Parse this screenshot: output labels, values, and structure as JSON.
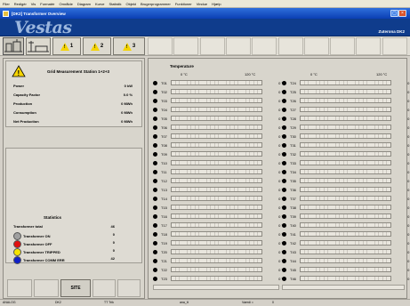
{
  "menu": [
    "Filer",
    "Redigér",
    "Vis",
    "Formatér",
    "Områlde",
    "Diagram",
    "Kurve",
    "Statistik",
    "Objekt",
    "Brugerprogrammer",
    "Funktioner",
    "Vindue",
    "Hjælp"
  ],
  "window_title": "[DK2] Transformer Overview",
  "banner": {
    "logo": "Vestas",
    "zone": "Zuterona DK2"
  },
  "toolbar": {
    "btn3": "1",
    "btn4": "2",
    "btn5": "3"
  },
  "station": {
    "title": "Grid Measurement Station 1+2+3",
    "rows": [
      {
        "label": "Power",
        "value": "0 kW"
      },
      {
        "label": "Capacity Factor",
        "value": "0.0 %"
      },
      {
        "label": "Production",
        "value": "0 MWh"
      },
      {
        "label": "Consumption",
        "value": "0 MWh"
      },
      {
        "label": "Net Production",
        "value": "0 MWh"
      }
    ]
  },
  "statistics": {
    "title": "Statistics",
    "total_label": "Transformer total",
    "total_value": "46",
    "rows": [
      {
        "label": "Transformer ON",
        "value": "0",
        "color": "#a0a0a0"
      },
      {
        "label": "Transformer OFF",
        "value": "0",
        "color": "#e01010"
      },
      {
        "label": "Transformer TRIPPED",
        "value": "0",
        "color": "#f5e400"
      },
      {
        "label": "Transformer COMM ERR",
        "value": "42",
        "color": "#1020c8"
      }
    ]
  },
  "site_button": "SITE",
  "temperature": {
    "title": "Temperature",
    "left_min": "0 °C",
    "left_max": "120 °C",
    "right_min": "0 °C",
    "right_max": "120 °C",
    "left": [
      {
        "label": "T01",
        "value": "0 °C"
      },
      {
        "label": "T02",
        "value": "0 °C"
      },
      {
        "label": "T03",
        "value": "0 °C"
      },
      {
        "label": "T04",
        "value": "0 °C"
      },
      {
        "label": "T05",
        "value": "0 °C"
      },
      {
        "label": "T06",
        "value": "0 °C"
      },
      {
        "label": "T07",
        "value": "0 °C"
      },
      {
        "label": "T08",
        "value": "0 °C"
      },
      {
        "label": "T09",
        "value": "0 °C"
      },
      {
        "label": "T10",
        "value": "0 °C"
      },
      {
        "label": "T11",
        "value": "0 °C"
      },
      {
        "label": "T12",
        "value": "0 °C"
      },
      {
        "label": "T13",
        "value": "0 °C"
      },
      {
        "label": "T14",
        "value": "0 °C"
      },
      {
        "label": "T15",
        "value": "0 °C"
      },
      {
        "label": "T16",
        "value": "0 °C"
      },
      {
        "label": "T17",
        "value": "0 °C"
      },
      {
        "label": "T18",
        "value": "0 °C"
      },
      {
        "label": "T19",
        "value": "0 °C"
      },
      {
        "label": "T20",
        "value": "0 °C"
      },
      {
        "label": "T21",
        "value": "0 °C"
      },
      {
        "label": "T22",
        "value": "0 °C"
      },
      {
        "label": "T23",
        "value": "0 °C"
      }
    ],
    "right": [
      {
        "label": "T24",
        "value": "0 °C"
      },
      {
        "label": "T25",
        "value": "0 °C"
      },
      {
        "label": "T26",
        "value": "0 °C"
      },
      {
        "label": "T27",
        "value": "0 °C"
      },
      {
        "label": "T28",
        "value": "0 °C"
      },
      {
        "label": "T29",
        "value": "0 °C"
      },
      {
        "label": "T30",
        "value": "0 °C"
      },
      {
        "label": "T31",
        "value": "0 °C"
      },
      {
        "label": "T32",
        "value": "0 °C"
      },
      {
        "label": "T33",
        "value": "0 °C"
      },
      {
        "label": "T34",
        "value": "0 °C"
      },
      {
        "label": "T35",
        "value": "0 °C"
      },
      {
        "label": "T36",
        "value": "0 °C"
      },
      {
        "label": "T37",
        "value": "0 °C"
      },
      {
        "label": "T38",
        "value": "0 °C"
      },
      {
        "label": "T39",
        "value": "0 °C"
      },
      {
        "label": "T40",
        "value": "0 °C"
      },
      {
        "label": "T41",
        "value": "0 °C"
      },
      {
        "label": "T42",
        "value": "0 °C"
      },
      {
        "label": "T43",
        "value": "0 °C"
      },
      {
        "label": "T44",
        "value": "0 °C"
      },
      {
        "label": "T45",
        "value": "0 °C"
      },
      {
        "label": "T46",
        "value": "0 °C"
      }
    ]
  },
  "statusbar": {
    "s1": "ANALOG",
    "s2": "DK2",
    "s3": "TT Trik",
    "s4": "ana_tt",
    "s5": "Vaerdi =",
    "s6": "0"
  }
}
